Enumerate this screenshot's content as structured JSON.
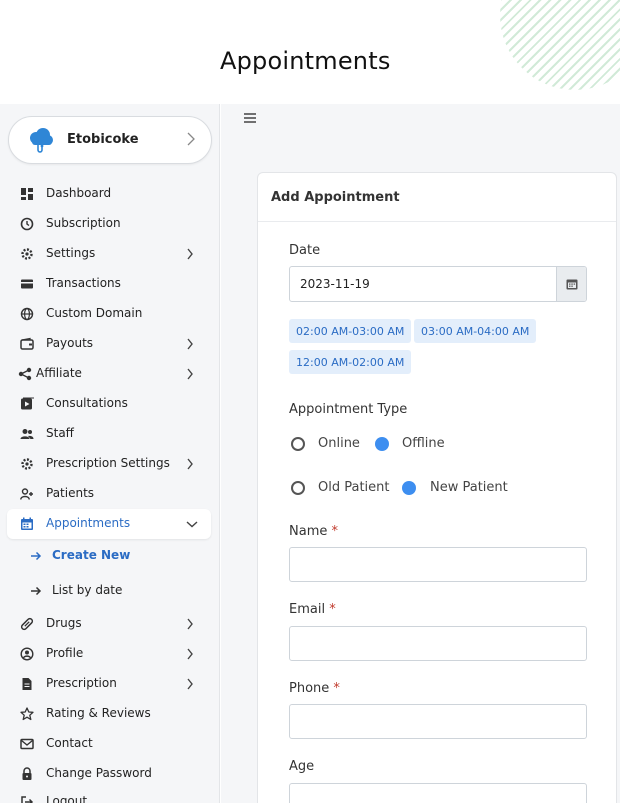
{
  "page": {
    "title": "Appointments"
  },
  "org": {
    "name": "Etobicoke"
  },
  "colors": {
    "accent": "#2b6cc4",
    "radio_on": "#3d8ef0",
    "slot_bg": "#e3eefb",
    "required": "#c0392b"
  },
  "sidebar": {
    "items": [
      {
        "label": "Dashboard",
        "icon": "dashboard-icon"
      },
      {
        "label": "Subscription",
        "icon": "clock-icon"
      },
      {
        "label": "Settings",
        "icon": "gear-icon"
      },
      {
        "label": "Transactions",
        "icon": "credit-card-icon"
      },
      {
        "label": "Custom Domain",
        "icon": "globe-icon"
      },
      {
        "label": "Payouts",
        "icon": "wallet-icon"
      },
      {
        "label": "Affiliate",
        "icon": "share-icon"
      },
      {
        "label": "Consultations",
        "icon": "video-icon"
      },
      {
        "label": "Staff",
        "icon": "users-icon"
      },
      {
        "label": "Prescription Settings",
        "icon": "gear-icon"
      },
      {
        "label": "Patients",
        "icon": "user-plus-icon"
      },
      {
        "label": "Appointments",
        "icon": "calendar-icon"
      },
      {
        "label": "Create New",
        "icon": "arrow-right-icon"
      },
      {
        "label": "List by date",
        "icon": "arrow-right-icon"
      },
      {
        "label": "Drugs",
        "icon": "pill-icon"
      },
      {
        "label": "Profile",
        "icon": "user-circle-icon"
      },
      {
        "label": "Prescription",
        "icon": "file-icon"
      },
      {
        "label": "Rating & Reviews",
        "icon": "star-icon"
      },
      {
        "label": "Contact",
        "icon": "mail-icon"
      },
      {
        "label": "Change Password",
        "icon": "lock-icon"
      },
      {
        "label": "Logout",
        "icon": "logout-icon"
      }
    ]
  },
  "form": {
    "title": "Add Appointment",
    "date_label": "Date",
    "date_value": "2023-11-19",
    "slots": [
      "02:00 AM-03:00 AM",
      "03:00 AM-04:00 AM",
      "12:00 AM-02:00 AM"
    ],
    "type_label": "Appointment Type",
    "type_options": [
      "Online",
      "Offline"
    ],
    "type_selected": "Offline",
    "patient_options": [
      "Old Patient",
      "New Patient"
    ],
    "patient_selected": "New Patient",
    "name_label": "Name",
    "email_label": "Email",
    "phone_label": "Phone",
    "age_label": "Age",
    "required_mark": "*"
  }
}
